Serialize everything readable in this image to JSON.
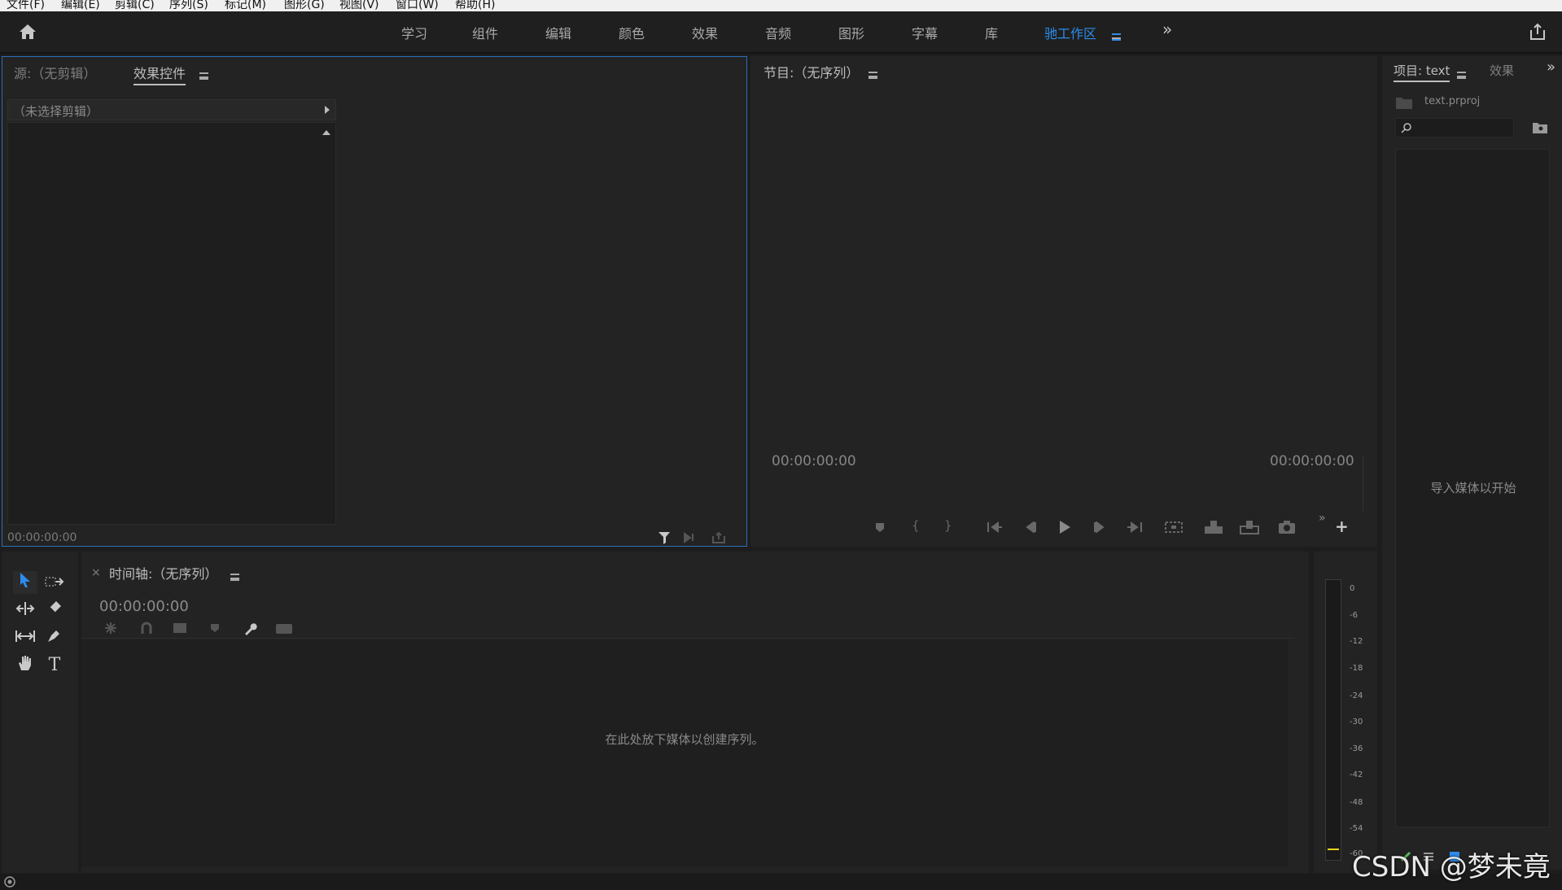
{
  "menubar": {
    "items": [
      "文件(F)",
      "编辑(E)",
      "剪辑(C)",
      "序列(S)",
      "标记(M)",
      "图形(G)",
      "视图(V)",
      "窗口(W)",
      "帮助(H)"
    ]
  },
  "workspace": {
    "tabs": [
      "学习",
      "组件",
      "编辑",
      "颜色",
      "效果",
      "音频",
      "图形",
      "字幕",
      "库"
    ],
    "active_tab": "驰工作区",
    "overflow": "»"
  },
  "source_panel": {
    "source_tab": "源:（无剪辑）",
    "effect_controls_tab": "效果控件",
    "no_clip": "（未选择剪辑）",
    "timecode": "00:00:00:00"
  },
  "program_panel": {
    "title": "节目:（无序列）",
    "timecode_left": "00:00:00:00",
    "timecode_right": "00:00:00:00",
    "overflow": "»",
    "add": "+"
  },
  "project_panel": {
    "tab_project": "项目: text",
    "tab_effects": "效果",
    "overflow": "»",
    "file_name": "text.prproj",
    "search_placeholder": "",
    "empty_message": "导入媒体以开始"
  },
  "timeline_panel": {
    "close": "×",
    "title": "时间轴:（无序列）",
    "timecode": "00:00:00:00",
    "drop_message": "在此处放下媒体以创建序列。"
  },
  "audio_meter": {
    "labels": [
      "0",
      "-6",
      "-12",
      "-18",
      "-24",
      "-30",
      "-36",
      "-42",
      "-48",
      "-54",
      "-60"
    ]
  },
  "watermark": "CSDN @梦未竟",
  "colors": {
    "accent": "#2d8ceb",
    "panel_bg": "#232323",
    "app_bg": "#1d1d1d"
  }
}
